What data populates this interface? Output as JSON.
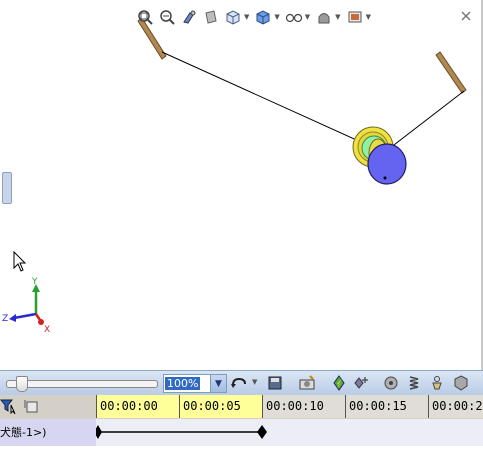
{
  "toolbar_top": {
    "items": [
      "zoom-to-fit-icon",
      "zoom-in-icon",
      "view-rotate-icon",
      "section-view-icon",
      "view-orientation-icon",
      "display-style-icon",
      "hide-show-icon",
      "appearance-icon",
      "scene-icon"
    ]
  },
  "zoom": {
    "value": "100%"
  },
  "timeline": {
    "ticks": [
      "00:00:00",
      "00:00:05",
      "00:00:10",
      "00:00:15",
      "00:00:2"
    ],
    "track_label": "犬態-1>)"
  },
  "colors": {
    "highlight": "#ffff99",
    "wheel_blue": "#6464f0",
    "wheel_yellow": "#f0e040",
    "wheel_green": "#90f0a0",
    "arm_brown": "#b08850"
  }
}
